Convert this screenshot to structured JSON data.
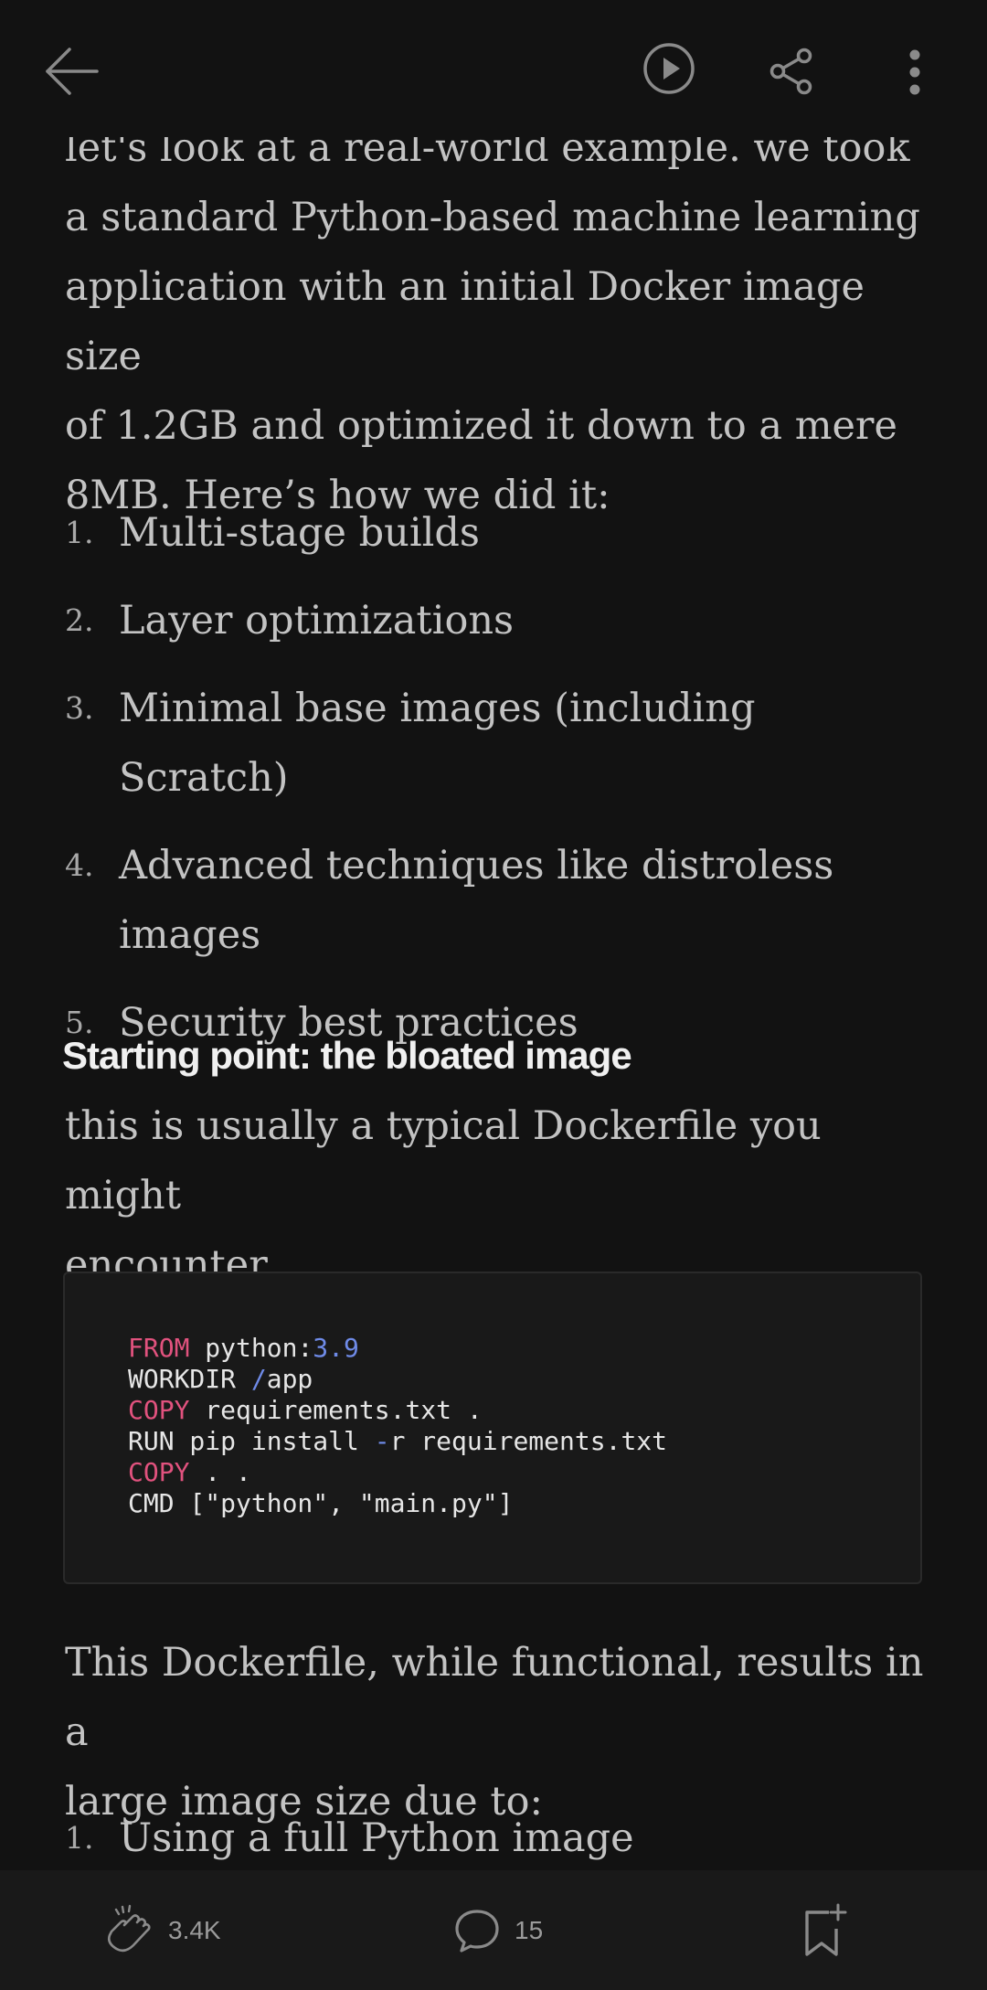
{
  "header": {
    "back_icon": "arrow-left-icon",
    "listen_icon": "play-circle-icon",
    "share_icon": "share-icon",
    "more_icon": "more-vertical-icon"
  },
  "article": {
    "intro_lines": [
      "let's look at a real-world example. we took",
      "a standard Python-based machine learning",
      "application with an initial Docker image size",
      "of 1.2GB and optimized it down to a mere",
      "8MB. Here’s how we did it:"
    ],
    "steps": [
      {
        "num": "1.",
        "lines": [
          "Multi-stage builds"
        ]
      },
      {
        "num": "2.",
        "lines": [
          "Layer optimizations"
        ]
      },
      {
        "num": "3.",
        "lines": [
          "Minimal base images (including Scratch)"
        ]
      },
      {
        "num": "4.",
        "lines": [
          "Advanced techniques like distroless",
          "images"
        ]
      },
      {
        "num": "5.",
        "lines": [
          "Security best practices"
        ]
      }
    ],
    "section_heading": "Starting point: the bloated image",
    "section_intro_lines": [
      "this is usually a typical Dockerfile you might",
      "encounter"
    ],
    "code": {
      "line1_kw": "FROM",
      "line1_rest": " python:",
      "line1_ver": "3.9",
      "line2_kw": "WORKDIR ",
      "line2_slash": "/",
      "line2_rest": "app",
      "line3_kw": "COPY",
      "line3_rest": " requirements.txt .",
      "line4_kw": "RUN pip install ",
      "line4_dash": "-",
      "line4_rest": "r requirements.txt",
      "line5_kw": "COPY",
      "line5_rest": " . .",
      "line6": "CMD [\"python\", \"main.py\"]"
    },
    "outro_lines": [
      "This Dockerfile, while functional, results in a",
      "large image size due to:"
    ],
    "reasons": [
      {
        "num": "1.",
        "text": "Using a full Python image"
      }
    ]
  },
  "footer": {
    "clap_icon": "clap-icon",
    "clap_count": "3.4K",
    "comment_icon": "comment-icon",
    "comment_count": "15",
    "bookmark_icon": "bookmark-add-icon"
  },
  "colors": {
    "background": "#121212",
    "text": "#c3c3c3",
    "heading": "#f0f0f0",
    "code_keyword": "#e1527e",
    "code_number": "#6f8be8"
  }
}
